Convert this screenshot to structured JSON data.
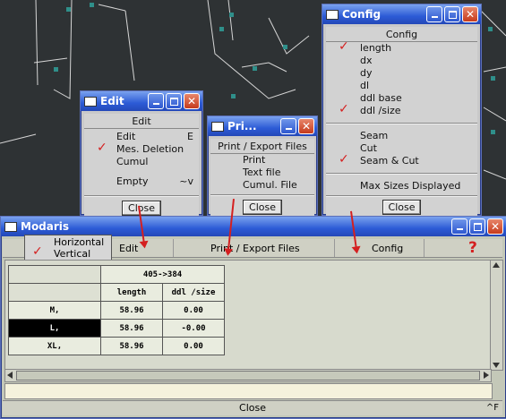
{
  "edit_window": {
    "title": "Edit",
    "header": "Edit",
    "items": [
      {
        "label": "Edit",
        "shortcut": "E",
        "checked": false
      },
      {
        "label": "Mes. Deletion",
        "shortcut": "",
        "checked": true
      },
      {
        "label": "Cumul",
        "shortcut": "",
        "checked": false
      },
      {
        "label": "Empty",
        "shortcut": "~v",
        "checked": false
      }
    ],
    "close_label": "Close"
  },
  "print_window": {
    "title": "Pri...",
    "header": "Print / Export Files",
    "items": [
      "Print",
      "Text file",
      "Cumul. File"
    ],
    "close_label": "Close"
  },
  "config_window": {
    "title": "Config",
    "header": "Config",
    "items_top": [
      {
        "label": "length",
        "checked": true
      },
      {
        "label": "dx",
        "checked": false
      },
      {
        "label": "dy",
        "checked": false
      },
      {
        "label": "dl",
        "checked": false
      },
      {
        "label": "ddl base",
        "checked": false
      },
      {
        "label": "ddl /size",
        "checked": true
      }
    ],
    "items_mid": [
      {
        "label": "Seam",
        "checked": false
      },
      {
        "label": "Cut",
        "checked": false
      },
      {
        "label": "Seam & Cut",
        "checked": true
      }
    ],
    "max_sizes_label": "Max Sizes Displayed",
    "close_label": "Close"
  },
  "main_window": {
    "title": "Modaris",
    "popup": {
      "horizontal": "Horizontal",
      "vertical": "Vertical",
      "vertical_checked": true
    },
    "menu": {
      "edit": "Edit",
      "print": "Print / Export Files",
      "config": "Config",
      "help": "?"
    },
    "table": {
      "top_header": "405->384",
      "col_headers": [
        "length",
        "ddl /size"
      ],
      "rows": [
        {
          "size": "M,",
          "length": "58.96",
          "ddl": "0.00"
        },
        {
          "size": "L,",
          "length": "58.96",
          "ddl": "-0.00"
        },
        {
          "size": "XL,",
          "length": "58.96",
          "ddl": "0.00"
        }
      ]
    },
    "close_label": "Close",
    "corner_label": "^F"
  }
}
